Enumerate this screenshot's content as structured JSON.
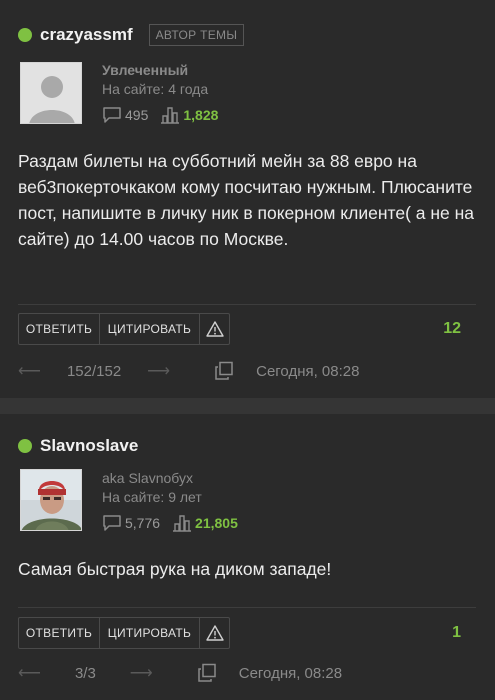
{
  "posts": [
    {
      "username": "crazyassmf",
      "badge": "АВТОР ТЕМЫ",
      "rank": "Увлеченный",
      "since": "На сайте: 4 года",
      "posts_count": "495",
      "rating": "1,828",
      "text": "Раздам билеты на субботний мейн за 88 евро на веб3покерточкаком кому посчитаю нужным. Плюсаните пост, напишите в личку ник в покерном клиенте( а не на сайте) до 14.00 часов по Москве.",
      "reply_label": "ОТВЕТИТЬ",
      "quote_label": "ЦИТИРОВАТЬ",
      "likes": "12",
      "pager": "152/152",
      "date": "Сегодня, 08:28"
    },
    {
      "username": "Slavnoslave",
      "rank": "aka Slavnобух",
      "since": "На сайте: 9 лет",
      "posts_count": "5,776",
      "rating": "21,805",
      "text": "Самая быстрая рука на диком западе!",
      "reply_label": "ОТВЕТИТЬ",
      "quote_label": "ЦИТИРОВАТЬ",
      "likes": "1",
      "pager": "3/3",
      "date": "Сегодня, 08:28"
    }
  ],
  "colors": {
    "accent": "#7fc142",
    "background": "#2a2a2a",
    "muted": "#8a8a8a"
  },
  "icons": [
    "online-dot",
    "comment-icon",
    "rating-icon",
    "warning-icon",
    "arrow-left-icon",
    "arrow-right-icon",
    "copy-link-icon"
  ]
}
